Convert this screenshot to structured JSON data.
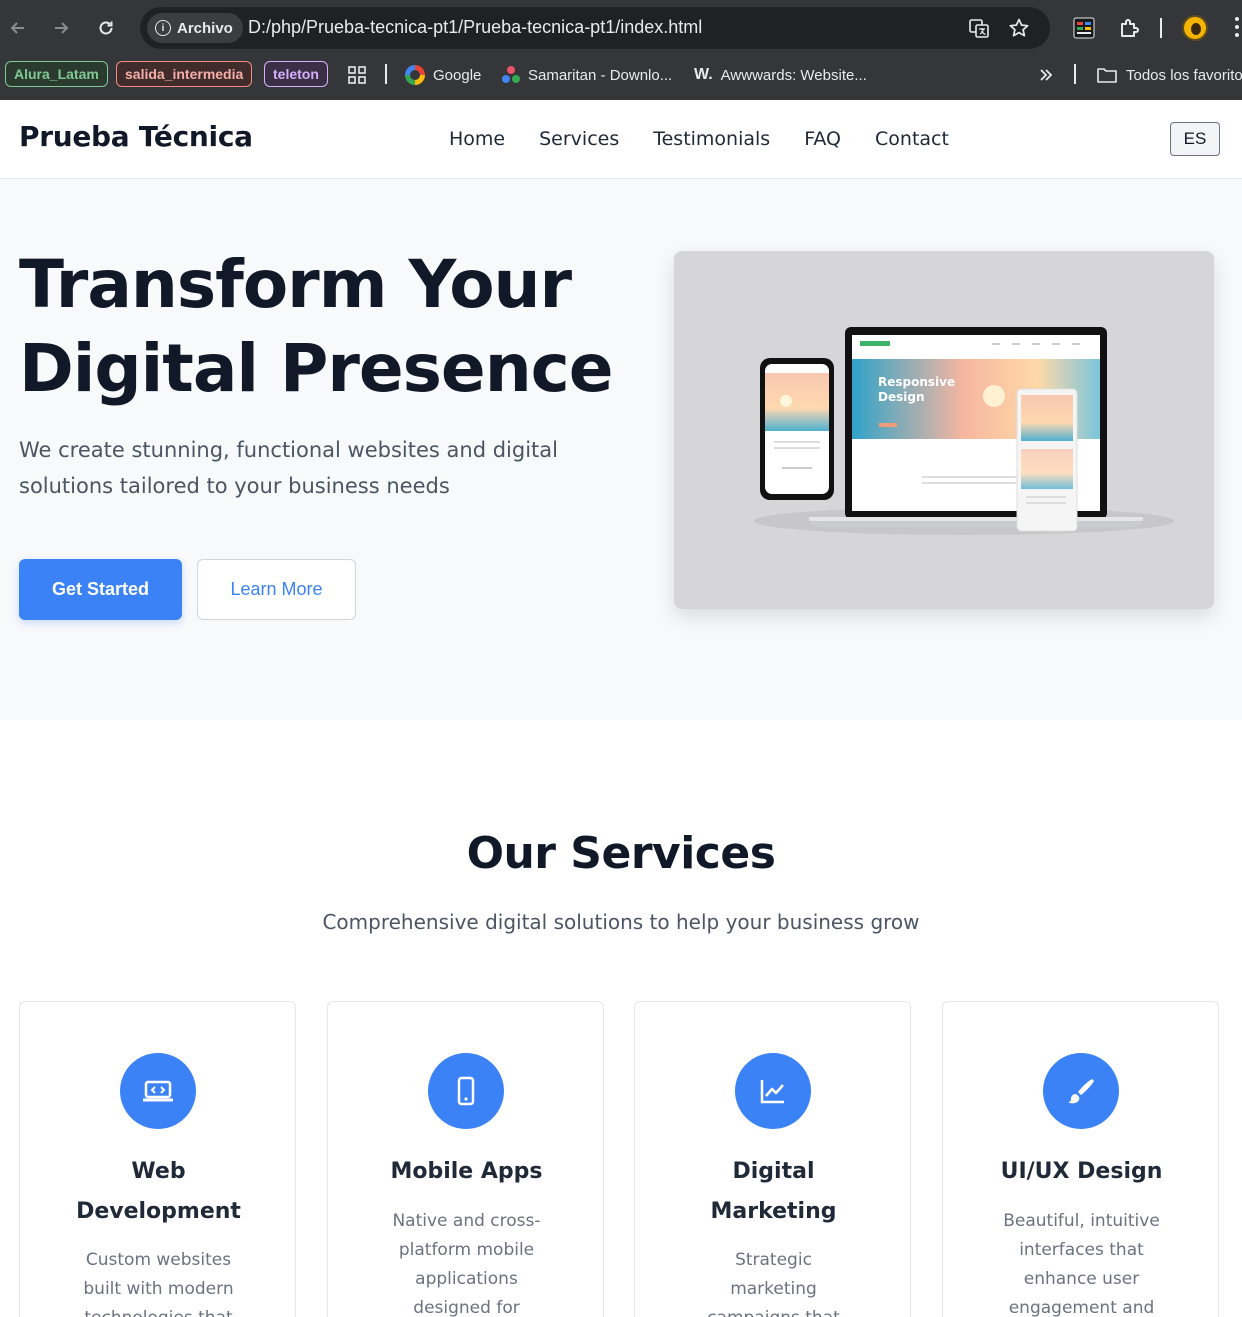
{
  "browser": {
    "site_info": "Archivo",
    "url": "D:/php/Prueba-tecnica-pt1/Prueba-tecnica-pt1/index.html",
    "bookmarks": {
      "tags": [
        {
          "label": "Alura_Latam",
          "color": "#81c995"
        },
        {
          "label": "salida_intermedia",
          "color": "#f28b82"
        },
        {
          "label": "teleton",
          "color": "#d7aefb"
        }
      ],
      "links": [
        "Google",
        "Samaritan - Downlo...",
        "Awwwards: Website..."
      ],
      "awwwards_mark": "W.",
      "all_bookmarks": "Todos los favoritos"
    }
  },
  "site": {
    "logo": "Prueba Técnica",
    "nav": [
      "Home",
      "Services",
      "Testimonials",
      "FAQ",
      "Contact"
    ],
    "lang_button": "ES",
    "accent_color": "#3b82f6"
  },
  "hero": {
    "title_line1": "Transform Your",
    "title_line2": "Digital Presence",
    "subtitle": "We create stunning, functional websites and digital solutions tailored to your business needs",
    "primary_cta": "Get Started",
    "secondary_cta": "Learn More",
    "mockup_heading_1": "Responsive",
    "mockup_heading_2": "Design"
  },
  "services": {
    "title": "Our Services",
    "subtitle": "Comprehensive digital solutions to help your business grow",
    "cards": [
      {
        "icon": "code-laptop-icon",
        "title_lines": [
          "Web",
          "Development"
        ],
        "text_lines": [
          "Custom websites",
          "built with modern",
          "technologies that"
        ]
      },
      {
        "icon": "mobile-phone-icon",
        "title_lines": [
          "Mobile Apps"
        ],
        "text_lines": [
          "Native and cross-",
          "platform mobile",
          "applications",
          "designed for"
        ]
      },
      {
        "icon": "chart-line-icon",
        "title_lines": [
          "Digital",
          "Marketing"
        ],
        "text_lines": [
          "Strategic",
          "marketing",
          "campaigns that"
        ]
      },
      {
        "icon": "paintbrush-icon",
        "title_lines": [
          "UI/UX Design"
        ],
        "text_lines": [
          "Beautiful, intuitive",
          "interfaces that",
          "enhance user",
          "engagement and"
        ]
      }
    ]
  }
}
